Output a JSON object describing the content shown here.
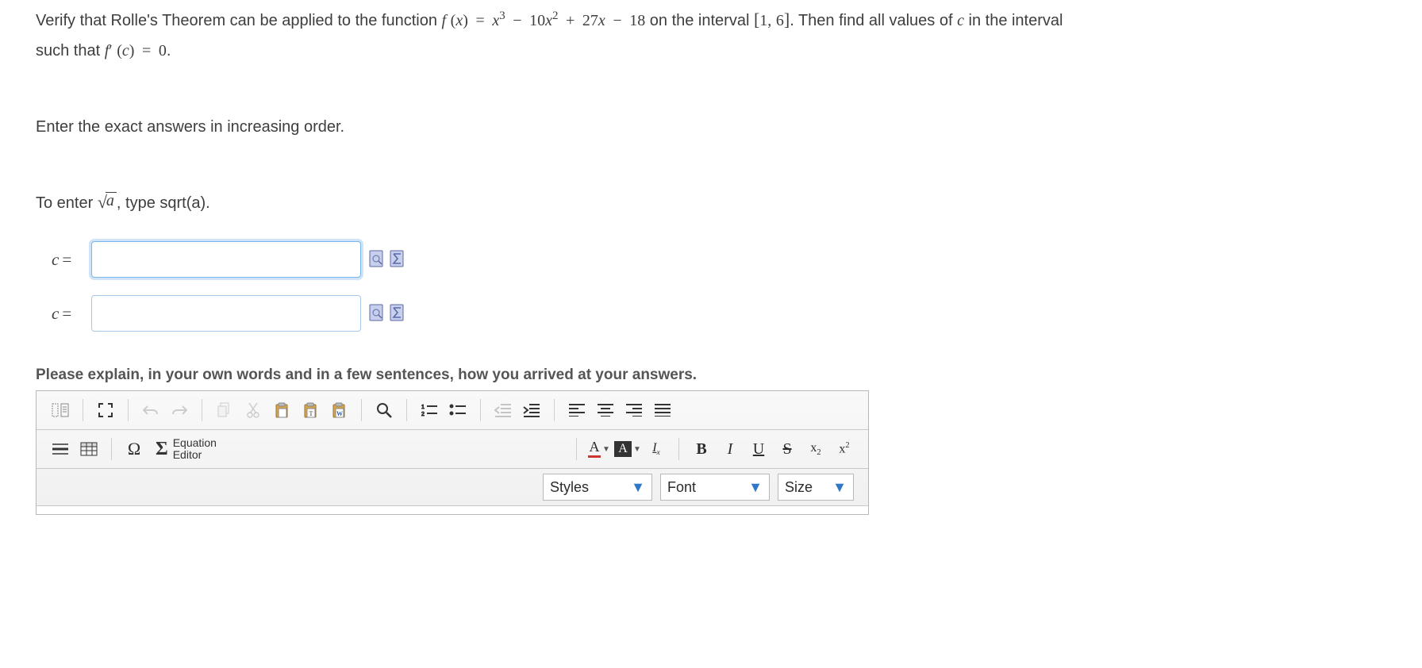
{
  "question": {
    "prefix": "Verify that Rolle's Theorem can be applied to the function ",
    "fn_f": "f",
    "fn_open": "(",
    "fn_x": "x",
    "fn_close": ")",
    "eq": "=",
    "term_x": "x",
    "exp3": "3",
    "minus": "−",
    "coef10": "10",
    "exp2": "2",
    "plus": "+",
    "coef27": "27",
    "coef18": "18",
    "on_interval": " on the interval ",
    "lbrack": "[",
    "interval_a": "1",
    "comma": ",",
    "interval_b": "6",
    "rbrack": "]",
    "after_interval": ". Then find all values of ",
    "c_var": "c",
    "in_interval": " in the interval",
    "such_that": "such that ",
    "fprime_f": "f",
    "prime": "′",
    "c_open": "(",
    "cvar2": "c",
    "c_close": ")",
    "zero": "0",
    "period": "."
  },
  "instr1": "Enter the exact answers in increasing order.",
  "instr2_pre": "To enter ",
  "sqrt_arg": "a",
  "instr2_post": ", type sqrt(a).",
  "answers": {
    "label_c": "c",
    "eq": "=",
    "rows": [
      {
        "value": ""
      },
      {
        "value": ""
      }
    ]
  },
  "explain_label": "Please explain, in your own words and in a few sentences, how you arrived at your answers.",
  "editor": {
    "equation_label_1": "Equation",
    "equation_label_2": "Editor",
    "styles_label": "Styles",
    "font_label": "Font",
    "size_label": "Size",
    "A": "A",
    "B": "B",
    "I": "I",
    "U": "U",
    "S": "S",
    "x": "x",
    "two": "2",
    "sigma": "Σ",
    "omega": "Ω",
    "Ix": "I"
  },
  "icons": {
    "preview": "preview-icon",
    "sigma": "sigma-icon"
  }
}
